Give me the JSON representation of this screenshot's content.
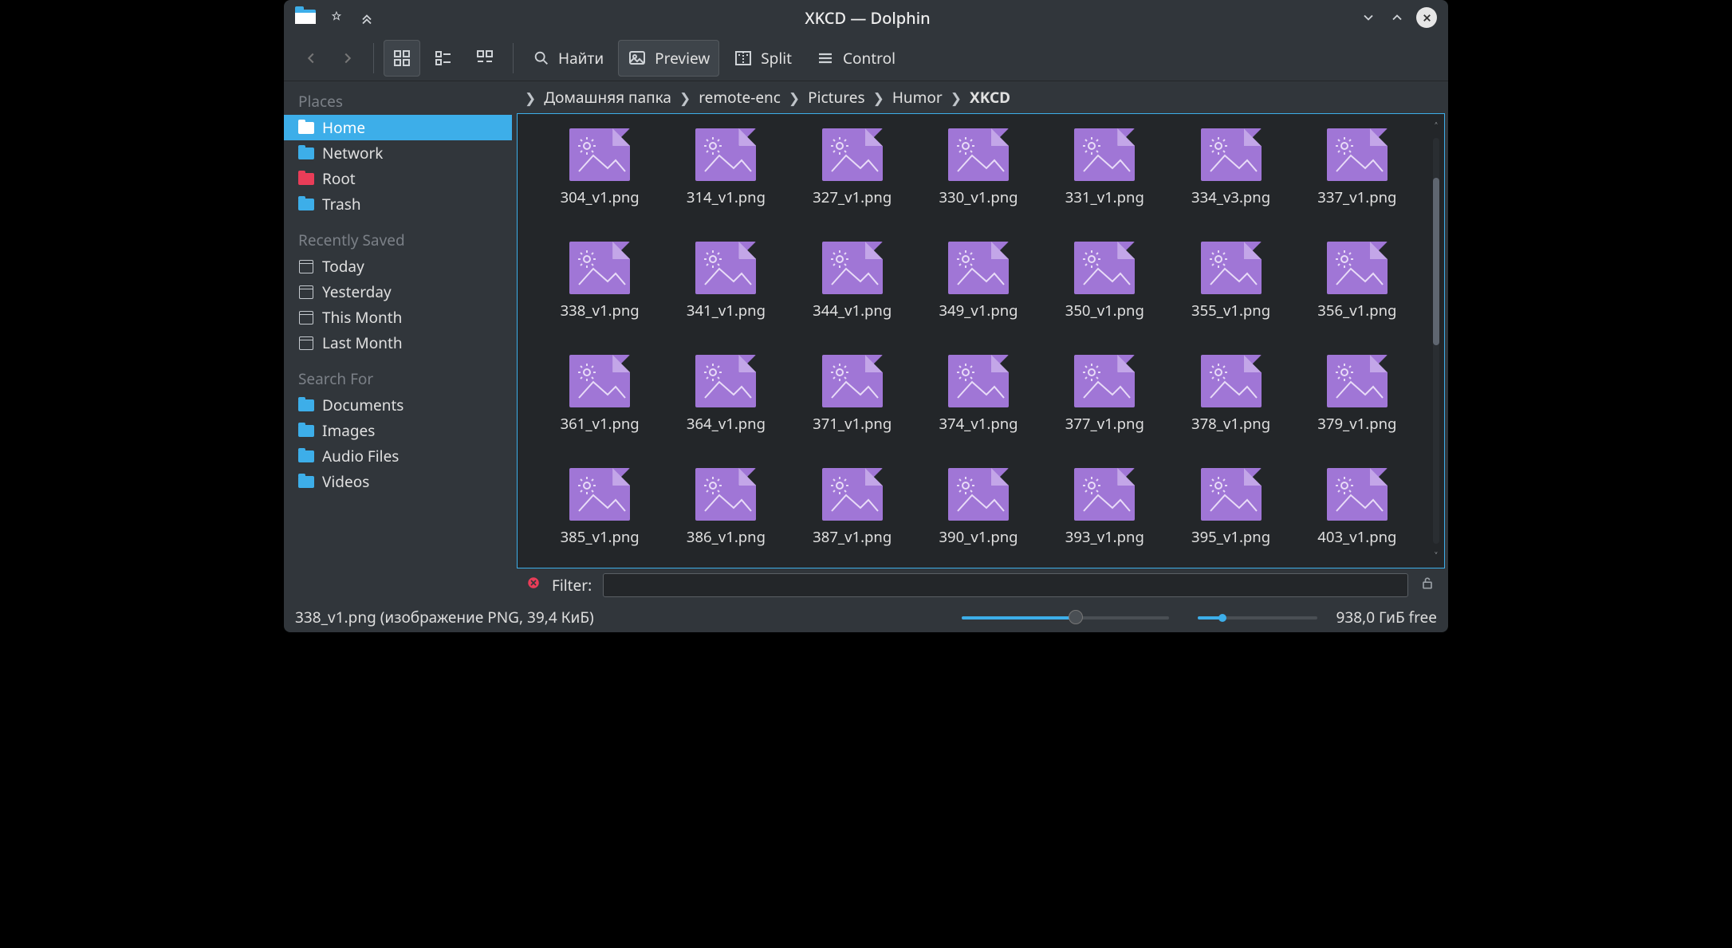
{
  "window": {
    "title": "XKCD — Dolphin"
  },
  "toolbar": {
    "find": "Найти",
    "preview": "Preview",
    "split": "Split",
    "control": "Control"
  },
  "breadcrumb": {
    "items": [
      "Домашняя папка",
      "remote-enc",
      "Pictures",
      "Humor"
    ],
    "current": "XKCD"
  },
  "sidebar": {
    "places_header": "Places",
    "recent_header": "Recently Saved",
    "search_header": "Search For",
    "places": [
      {
        "label": "Home",
        "selected": true,
        "color": "blue"
      },
      {
        "label": "Network",
        "selected": false,
        "color": "blue"
      },
      {
        "label": "Root",
        "selected": false,
        "color": "red"
      },
      {
        "label": "Trash",
        "selected": false,
        "color": "blue"
      }
    ],
    "recent": [
      {
        "label": "Today"
      },
      {
        "label": "Yesterday"
      },
      {
        "label": "This Month"
      },
      {
        "label": "Last Month"
      }
    ],
    "search": [
      {
        "label": "Documents"
      },
      {
        "label": "Images"
      },
      {
        "label": "Audio Files"
      },
      {
        "label": "Videos"
      }
    ]
  },
  "files": [
    "304_v1.png",
    "314_v1.png",
    "327_v1.png",
    "330_v1.png",
    "331_v1.png",
    "334_v3.png",
    "337_v1.png",
    "338_v1.png",
    "341_v1.png",
    "344_v1.png",
    "349_v1.png",
    "350_v1.png",
    "355_v1.png",
    "356_v1.png",
    "361_v1.png",
    "364_v1.png",
    "371_v1.png",
    "374_v1.png",
    "377_v1.png",
    "378_v1.png",
    "379_v1.png",
    "385_v1.png",
    "386_v1.png",
    "387_v1.png",
    "390_v1.png",
    "393_v1.png",
    "395_v1.png",
    "403_v1.png"
  ],
  "filter": {
    "label": "Filter:",
    "value": ""
  },
  "status": {
    "text": "338_v1.png (изображение PNG, 39,4 КиБ)",
    "free": "938,0 ГиБ free"
  }
}
